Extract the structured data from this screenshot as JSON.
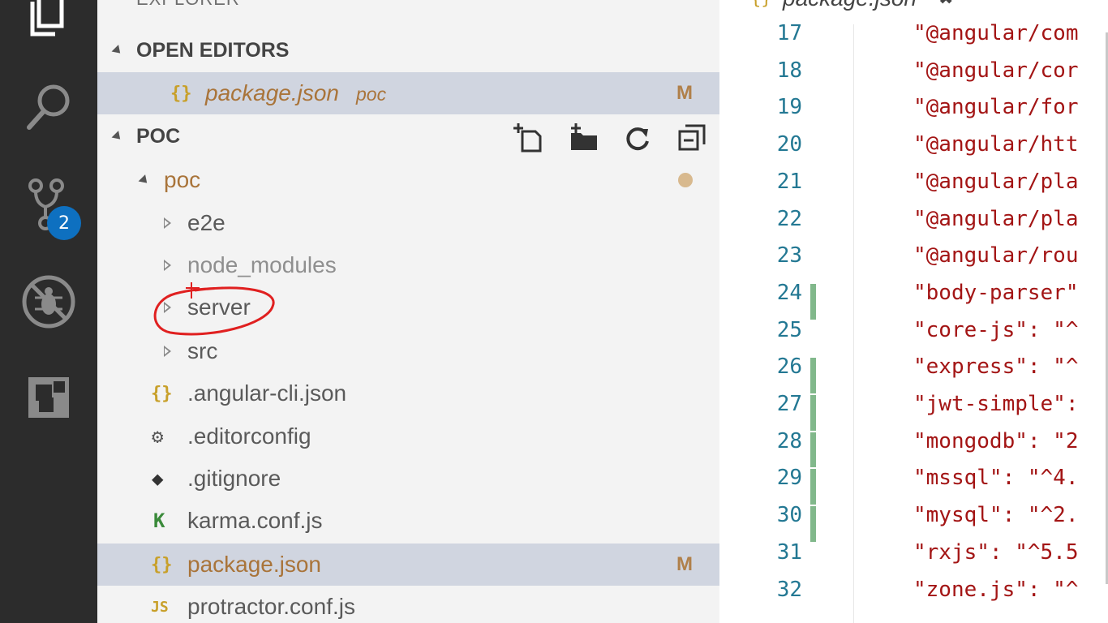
{
  "activity_bar": {
    "items": [
      {
        "icon": "files-icon"
      },
      {
        "icon": "search-icon"
      },
      {
        "icon": "source-control-icon",
        "badge": "2"
      },
      {
        "icon": "debug-icon"
      },
      {
        "icon": "extensions-icon"
      }
    ]
  },
  "sidebar": {
    "title": "EXPLORER",
    "open_editors": {
      "header": "OPEN EDITORS",
      "items": [
        {
          "name": "package.json",
          "folder": "poc",
          "status": "M"
        }
      ]
    },
    "project": {
      "header": "POC",
      "toolbar": [
        {
          "icon": "new-file-icon"
        },
        {
          "icon": "new-folder-icon"
        },
        {
          "icon": "refresh-icon"
        },
        {
          "icon": "collapse-all-icon"
        }
      ],
      "tree": [
        {
          "label": "poc",
          "type": "folder",
          "expanded": true
        },
        {
          "label": "e2e",
          "type": "folder"
        },
        {
          "label": "node_modules",
          "type": "folder"
        },
        {
          "label": "server",
          "type": "folder"
        },
        {
          "label": "src",
          "type": "folder"
        },
        {
          "label": ".angular-cli.json",
          "type": "json",
          "icon_glyph": "{}"
        },
        {
          "label": ".editorconfig",
          "type": "config"
        },
        {
          "label": ".gitignore",
          "type": "git"
        },
        {
          "label": "karma.conf.js",
          "type": "karma",
          "icon_glyph": "K"
        },
        {
          "label": "package.json",
          "type": "json",
          "icon_glyph": "{}",
          "status": "M"
        },
        {
          "label": "protractor.conf.js",
          "type": "js",
          "icon_glyph": "JS"
        }
      ]
    }
  },
  "editor": {
    "tab_title": "package.json",
    "lines": [
      {
        "num": "17",
        "text": "\"@angular/com"
      },
      {
        "num": "18",
        "text": "\"@angular/cor"
      },
      {
        "num": "19",
        "text": "\"@angular/for"
      },
      {
        "num": "20",
        "text": "\"@angular/htt"
      },
      {
        "num": "21",
        "text": "\"@angular/pla"
      },
      {
        "num": "22",
        "text": "\"@angular/pla"
      },
      {
        "num": "23",
        "text": "\"@angular/rou"
      },
      {
        "num": "24",
        "text": "\"body-parser\""
      },
      {
        "num": "25",
        "text": "\"core-js\": \"^"
      },
      {
        "num": "26",
        "text": "\"express\": \"^"
      },
      {
        "num": "27",
        "text": "\"jwt-simple\":"
      },
      {
        "num": "28",
        "text": "\"mongodb\": \"2"
      },
      {
        "num": "29",
        "text": "\"mssql\": \"^4."
      },
      {
        "num": "30",
        "text": "\"mysql\": \"^2."
      },
      {
        "num": "31",
        "text": "\"rxjs\": \"^5.5"
      },
      {
        "num": "32",
        "text": "\"zone.js\": \"^"
      }
    ]
  },
  "colors": {
    "activity_bg": "#2c2c2c",
    "sidebar_bg": "#f3f3f3",
    "selection_bg": "#d0d5e0",
    "modified": "#b0804a",
    "line_number": "#237893",
    "string": "#a31515",
    "gutter_added": "#81b88b",
    "annotation": "#e02020"
  }
}
